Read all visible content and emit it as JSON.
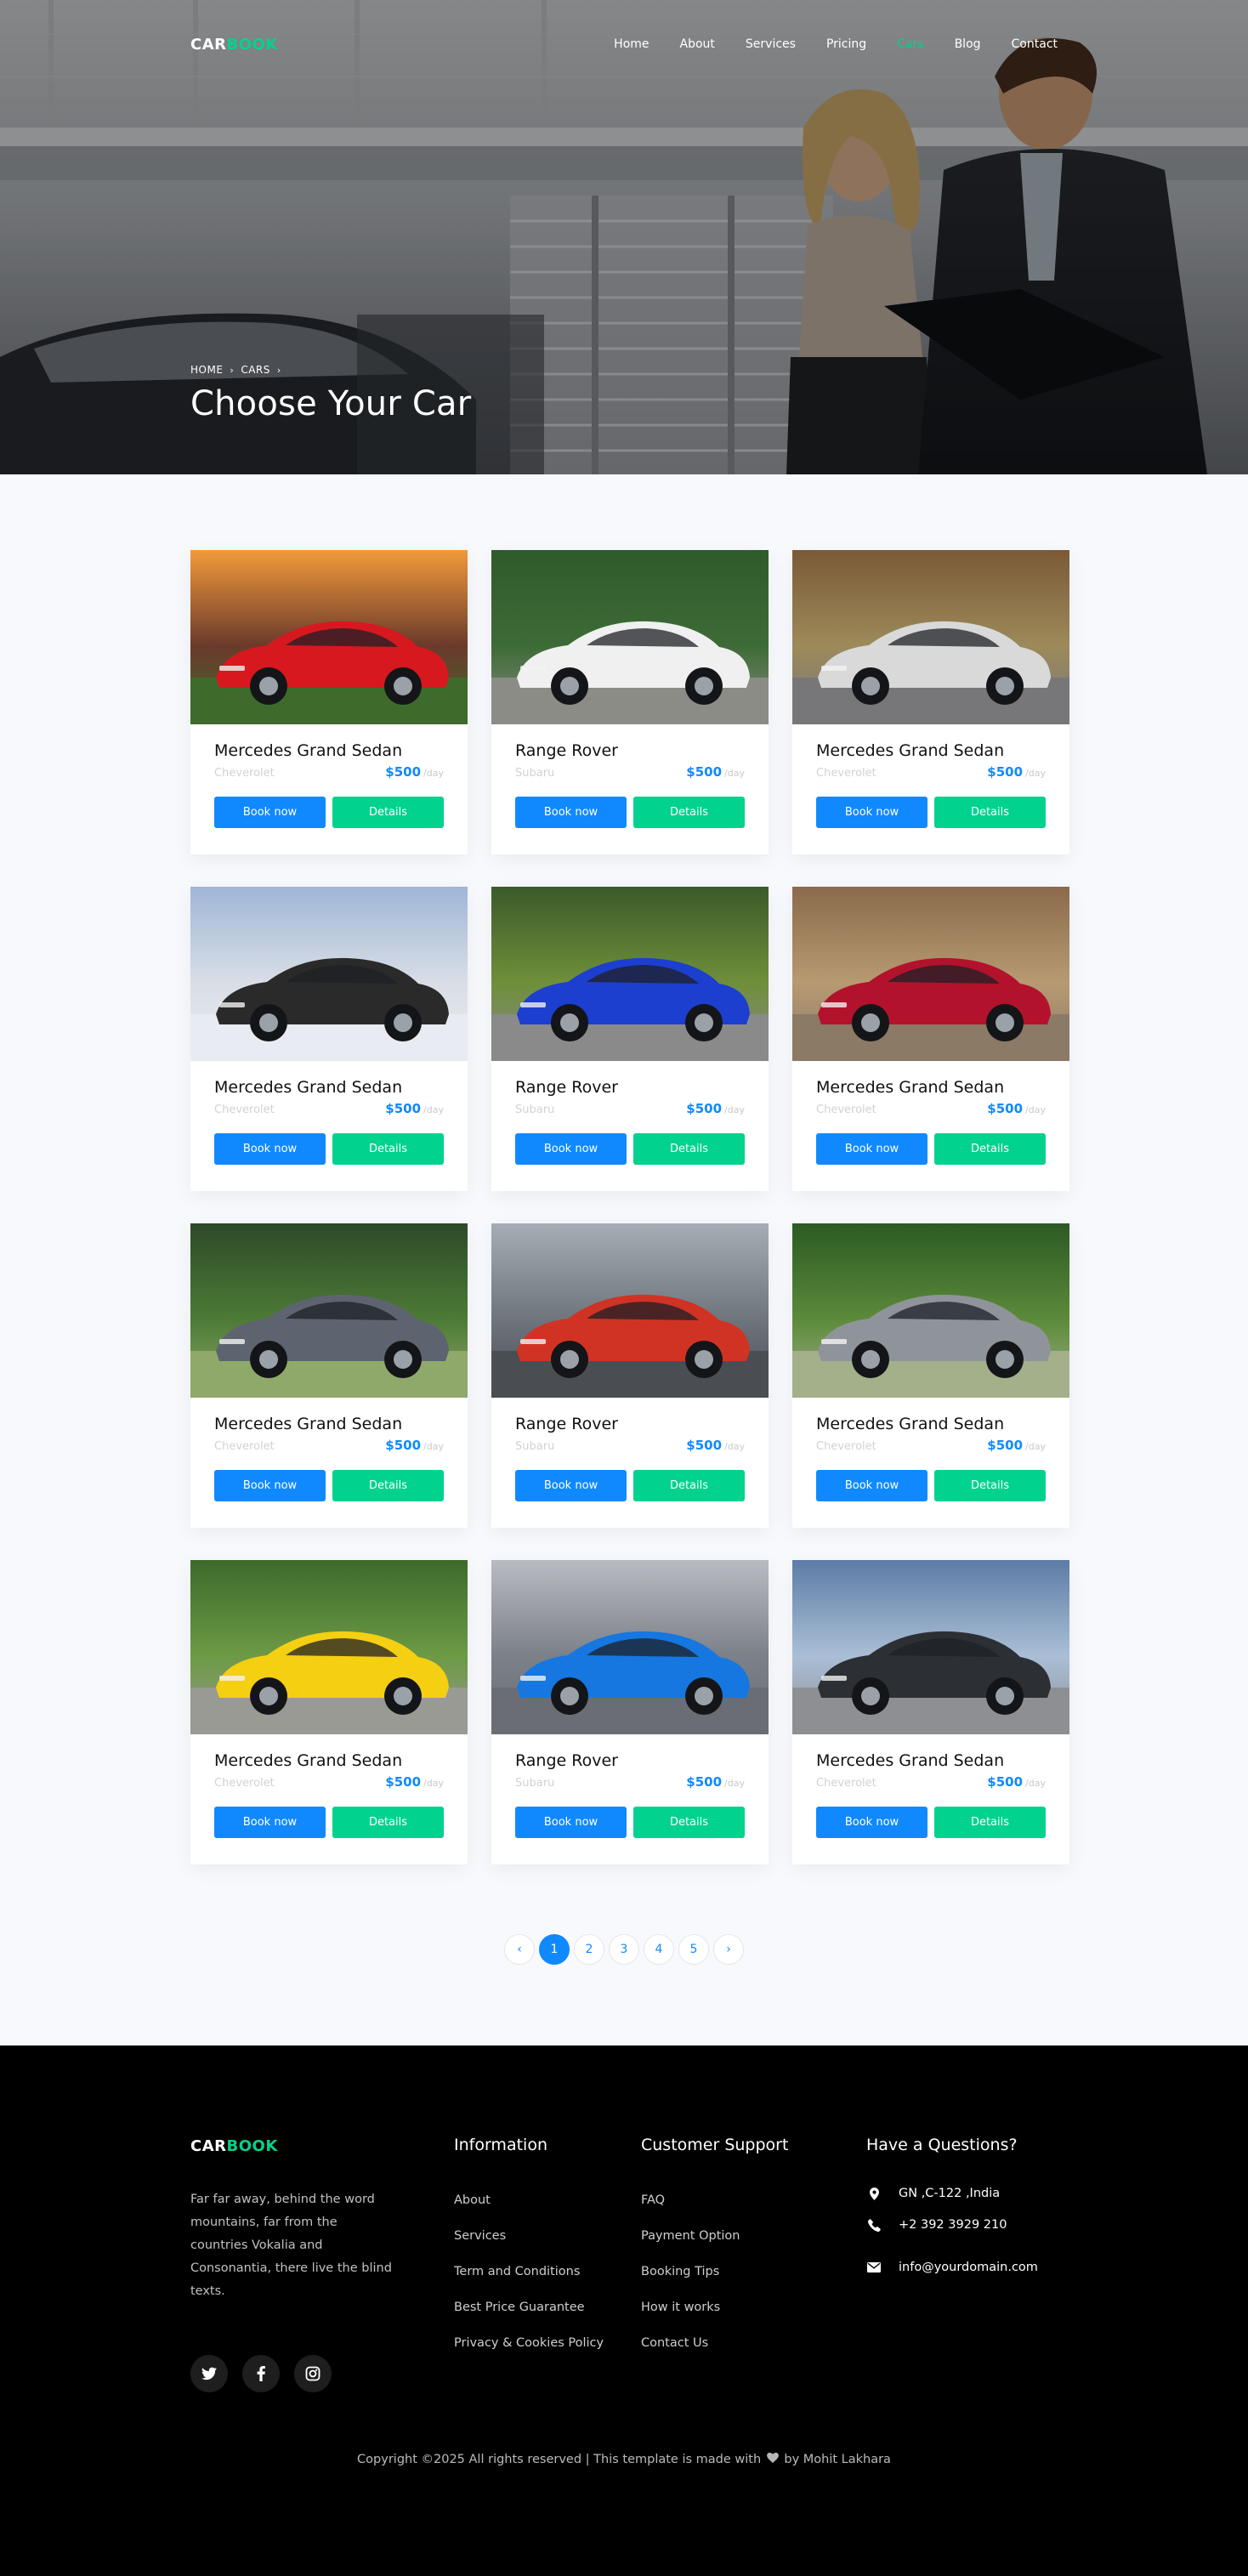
{
  "nav": {
    "logo_main": "CAR",
    "logo_accent": "BOOK",
    "items": [
      "Home",
      "About",
      "Services",
      "Pricing",
      "Cars",
      "Blog",
      "Contact"
    ],
    "active": "Cars"
  },
  "hero": {
    "breadcrumb": [
      "HOME",
      "CARS"
    ],
    "title": "Choose Your Car"
  },
  "cars": [
    {
      "name": "Mercedes Grand Sedan",
      "brand": "Cheverolet",
      "price": "$500",
      "per": "/day",
      "color": "#d7181f",
      "scene": "sunset-mountains"
    },
    {
      "name": "Range Rover",
      "brand": "Subaru",
      "price": "$500",
      "per": "/day",
      "color": "#f0f0f0",
      "scene": "forest"
    },
    {
      "name": "Mercedes Grand Sedan",
      "brand": "Cheverolet",
      "price": "$500",
      "per": "/day",
      "color": "#d9d9d9",
      "scene": "cabins"
    },
    {
      "name": "Mercedes Grand Sedan",
      "brand": "Cheverolet",
      "price": "$500",
      "per": "/day",
      "color": "#2a2a2a",
      "scene": "cloudy-sky"
    },
    {
      "name": "Range Rover",
      "brand": "Subaru",
      "price": "$500",
      "per": "/day",
      "color": "#1c3fcf",
      "scene": "trees"
    },
    {
      "name": "Mercedes Grand Sedan",
      "brand": "Cheverolet",
      "price": "$500",
      "per": "/day",
      "color": "#b3122c",
      "scene": "blurred-road"
    },
    {
      "name": "Mercedes Grand Sedan",
      "brand": "Cheverolet",
      "price": "$500",
      "per": "/day",
      "color": "#5d6470",
      "scene": "garden"
    },
    {
      "name": "Range Rover",
      "brand": "Subaru",
      "price": "$500",
      "per": "/day",
      "color": "#d03324",
      "scene": "buildings"
    },
    {
      "name": "Mercedes Grand Sedan",
      "brand": "Cheverolet",
      "price": "$500",
      "per": "/day",
      "color": "#8f949a",
      "scene": "green-trees"
    },
    {
      "name": "Mercedes Grand Sedan",
      "brand": "Cheverolet",
      "price": "$500",
      "per": "/day",
      "color": "#f5cf12",
      "scene": "park"
    },
    {
      "name": "Range Rover",
      "brand": "Subaru",
      "price": "$500",
      "per": "/day",
      "color": "#1677e0",
      "scene": "parking"
    },
    {
      "name": "Mercedes Grand Sedan",
      "brand": "Cheverolet",
      "price": "$500",
      "per": "/day",
      "color": "#2c3035",
      "scene": "dramatic-sky"
    }
  ],
  "buttons": {
    "book": "Book now",
    "details": "Details"
  },
  "pagination": {
    "prev": "‹",
    "pages": [
      "1",
      "2",
      "3",
      "4",
      "5"
    ],
    "active": "1",
    "next": "›"
  },
  "footer": {
    "logo_main": "CAR",
    "logo_accent": "BOOK",
    "description": "Far far away, behind the word mountains, far from the countries Vokalia and Consonantia, there live the blind texts.",
    "socials": [
      "twitter-icon",
      "facebook-icon",
      "instagram-icon"
    ],
    "information": {
      "title": "Information",
      "links": [
        "About",
        "Services",
        "Term and Conditions",
        "Best Price Guarantee",
        "Privacy & Cookies Policy"
      ]
    },
    "support": {
      "title": "Customer Support",
      "links": [
        "FAQ",
        "Payment Option",
        "Booking Tips",
        "How it works",
        "Contact Us"
      ]
    },
    "contact": {
      "title": "Have a Questions?",
      "address": "GN ,C-122 ,India",
      "phone": "+2 392 3929 210",
      "email": "info@yourdomain.com"
    },
    "copyright_pre": "Copyright ©2025 All rights reserved | This template is made with",
    "copyright_post": "by Mohit Lakhara"
  },
  "colors": {
    "primary": "#1089ff",
    "accent": "#01d28e",
    "footer_bg": "#000000",
    "page_bg": "#f8f9fd"
  }
}
